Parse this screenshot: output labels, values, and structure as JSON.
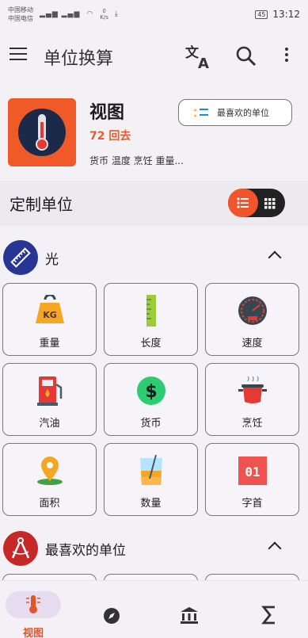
{
  "status_bar": {
    "carrier1": "中国移动",
    "carrier2": "中国电信",
    "hd": "HD",
    "speed_value": "0",
    "speed_unit": "K/s",
    "battery": "45",
    "time": "13:12"
  },
  "app_bar": {
    "title": "单位换算",
    "icons": [
      "menu-icon",
      "translate-icon",
      "search-icon",
      "more-vert-icon"
    ]
  },
  "category": {
    "title": "视图",
    "count": "72 回去",
    "description": "货币 温度 烹饪 重量...",
    "favorite_button": "最喜欢的单位",
    "icon": "thermometer-icon"
  },
  "custom_units": {
    "title": "定制单位",
    "toggle_icons": [
      "list-view-icon",
      "grid-view-icon"
    ]
  },
  "sections": [
    {
      "label": "光",
      "icon": "ruler-icon",
      "color": "#283593",
      "tiles": [
        {
          "label": "重量",
          "icon": "weight-icon"
        },
        {
          "label": "长度",
          "icon": "ruler-bar-icon"
        },
        {
          "label": "速度",
          "icon": "speedometer-icon"
        },
        {
          "label": "汽油",
          "icon": "fuel-pump-icon"
        },
        {
          "label": "货币",
          "icon": "dollar-icon"
        },
        {
          "label": "烹饪",
          "icon": "cooking-pot-icon"
        },
        {
          "label": "面积",
          "icon": "location-pin-icon"
        },
        {
          "label": "数量",
          "icon": "beaker-icon"
        },
        {
          "label": "字首",
          "icon": "digit-icon"
        }
      ]
    },
    {
      "label": "最喜欢的单位",
      "icon": "compass-drawing-icon",
      "color": "#c62828"
    }
  ],
  "weight_tile_text": "KG",
  "digit_tile_text": "01",
  "bottom_nav": {
    "active_label": "视图",
    "items": [
      "thermometer-icon",
      "compass-icon",
      "bank-icon",
      "sigma-icon"
    ]
  },
  "colors": {
    "accent": "#f05a28",
    "nav_pill": "#e7dcef"
  }
}
